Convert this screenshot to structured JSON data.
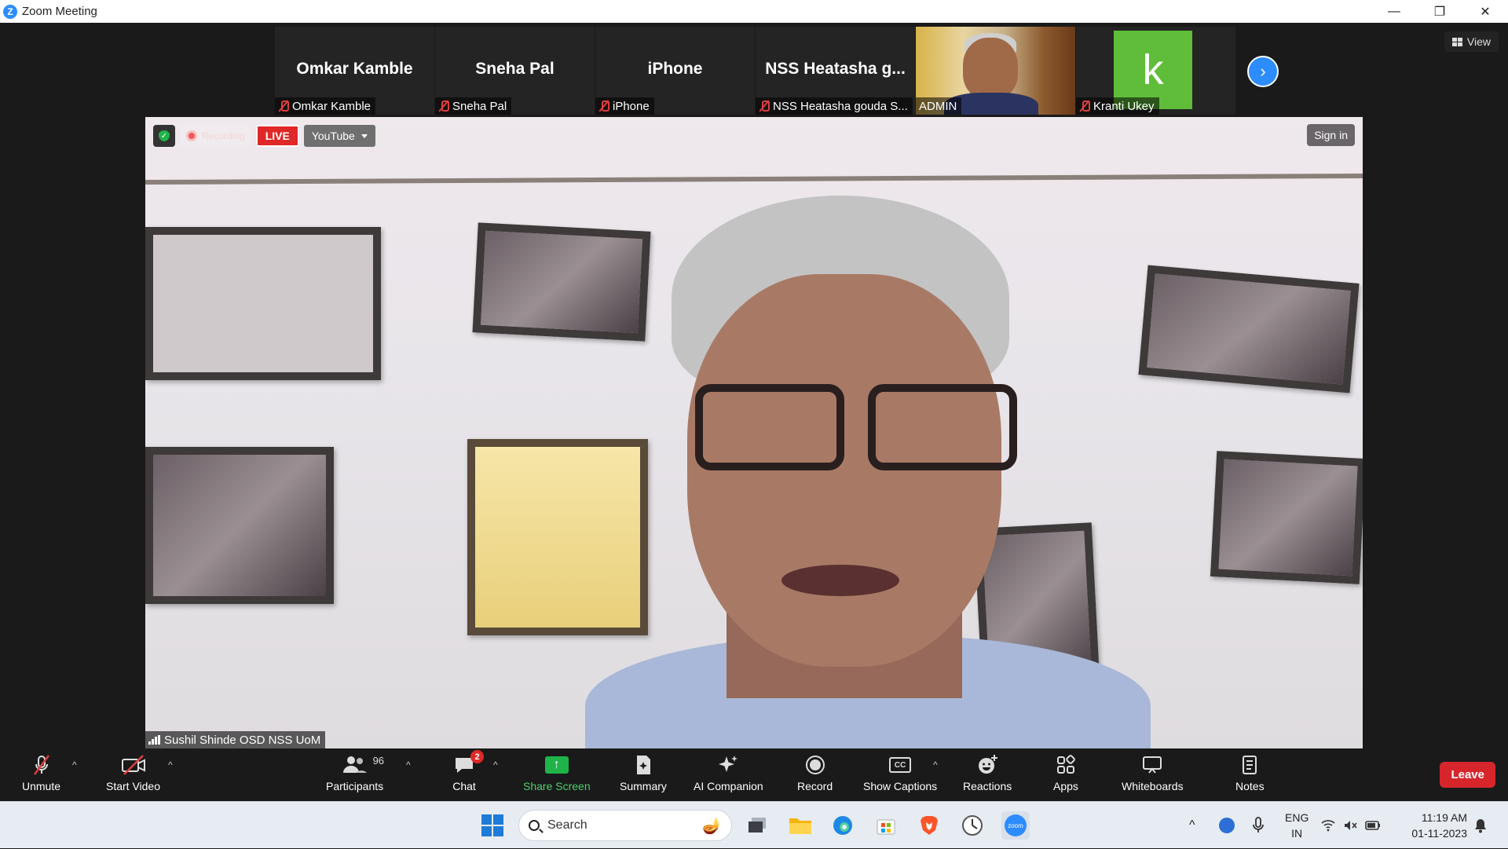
{
  "window": {
    "title": "Zoom Meeting",
    "minimize": "—",
    "restore": "❐",
    "close": "✕"
  },
  "meeting": {
    "view_label": "View",
    "thumbnails": [
      {
        "big_name": "Omkar Kamble",
        "name": "Omkar Kamble",
        "muted": true
      },
      {
        "big_name": "Sneha Pal",
        "name": "Sneha Pal",
        "muted": true
      },
      {
        "big_name": "iPhone",
        "name": "iPhone",
        "muted": true
      },
      {
        "big_name": "NSS Heatasha g...",
        "name": "NSS Heatasha gouda S...",
        "muted": true
      },
      {
        "big_name": "",
        "name": "ADMIN",
        "muted": false,
        "video": true
      },
      {
        "big_name": "",
        "name": "Kranti Ukey",
        "muted": true,
        "avatar_letter": "k",
        "avatar_color": "#5fbd3a"
      }
    ],
    "next_arrow": "›",
    "recording_label": "Recording",
    "live_label": "LIVE",
    "stream_target": "YouTube",
    "sign_in": "Sign in",
    "speaker_name": "Sushil Shinde OSD NSS UoM"
  },
  "toolbar": {
    "unmute": "Unmute",
    "start_video": "Start Video",
    "participants": "Participants",
    "participants_count": "96",
    "chat": "Chat",
    "chat_badge": "2",
    "share_screen": "Share Screen",
    "summary": "Summary",
    "ai_companion": "AI Companion",
    "record": "Record",
    "show_captions": "Show Captions",
    "cc": "CC",
    "reactions": "Reactions",
    "apps": "Apps",
    "whiteboards": "Whiteboards",
    "notes": "Notes",
    "leave": "Leave",
    "caret": "^"
  },
  "taskbar": {
    "search_placeholder": "Search",
    "lang_top": "ENG",
    "lang_bottom": "IN",
    "time": "11:19 AM",
    "date": "01-11-2023",
    "tray_up": "^",
    "zoom_label": "zoom"
  },
  "colors": {
    "accent": "#2d8cff",
    "leave_red": "#d6262c",
    "share_green": "#1fb34a",
    "live_red": "#e02828"
  }
}
